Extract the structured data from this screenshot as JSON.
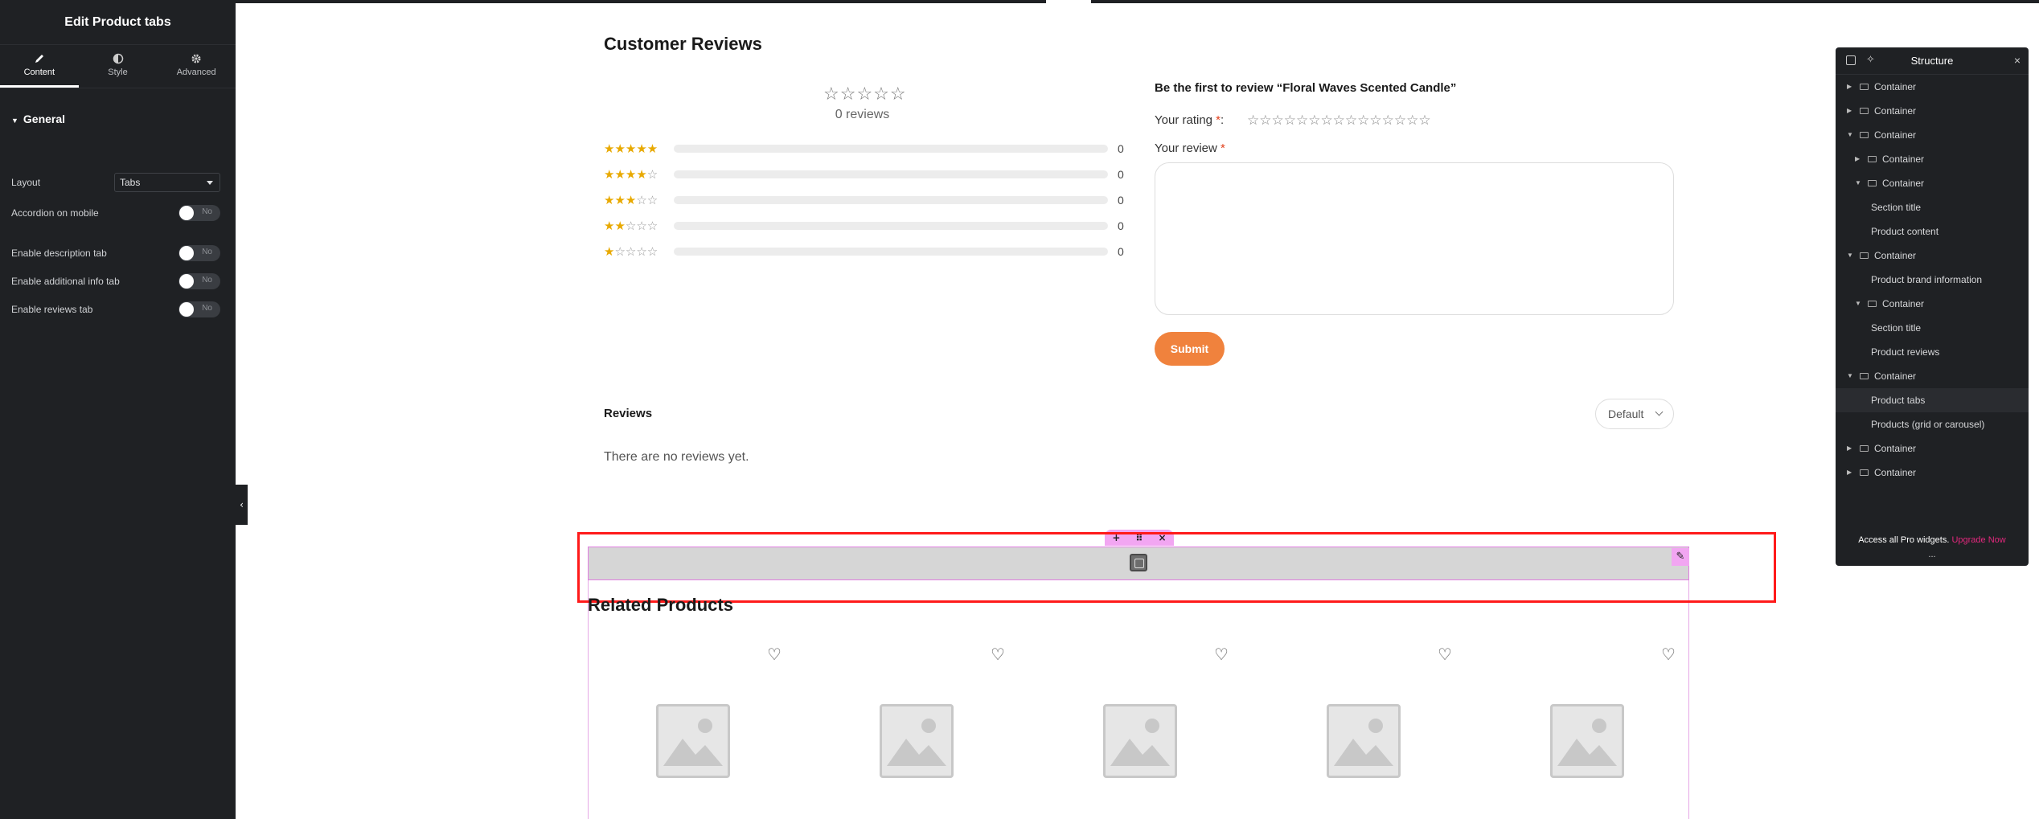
{
  "panel": {
    "title": "Edit Product tabs",
    "tabs": [
      {
        "label": "Content",
        "icon": "pencil-icon"
      },
      {
        "label": "Style",
        "icon": "half-circle-icon"
      },
      {
        "label": "Advanced",
        "icon": "gear-icon"
      }
    ],
    "section": "General",
    "layout_label": "Layout",
    "layout_value": "Tabs",
    "toggles": [
      {
        "label": "Accordion on mobile",
        "state": "No"
      },
      {
        "label": "Enable description tab",
        "state": "No"
      },
      {
        "label": "Enable additional info tab",
        "state": "No"
      },
      {
        "label": "Enable reviews tab",
        "state": "No"
      }
    ]
  },
  "reviews": {
    "title": "Customer Reviews",
    "avg_stars": "☆☆☆☆☆",
    "count_text": "0 reviews",
    "rows": [
      {
        "filled": "★★★★★",
        "empty": "",
        "count": "0"
      },
      {
        "filled": "★★★★",
        "empty": "☆",
        "count": "0"
      },
      {
        "filled": "★★★",
        "empty": "☆☆",
        "count": "0"
      },
      {
        "filled": "★★",
        "empty": "☆☆☆",
        "count": "0"
      },
      {
        "filled": "★",
        "empty": "☆☆☆☆",
        "count": "0"
      }
    ],
    "form_title": "Be the first to review “Floral Waves Scented Candle”",
    "rating_label": "Your rating",
    "rating_stars": "☆☆☆☆☆☆☆☆☆☆☆☆☆☆☆",
    "review_label": "Your review",
    "required_mark": "*",
    "submit_label": "Submit",
    "list_title": "Reviews",
    "sort_value": "Default",
    "empty_text": "There are no reviews yet."
  },
  "element_handle": {
    "add": "+",
    "move": "⠿",
    "close": "×"
  },
  "related": {
    "title": "Related Products"
  },
  "structure": {
    "title": "Structure",
    "items": [
      {
        "label": "Container",
        "level": 0,
        "expand": "right",
        "box": true
      },
      {
        "label": "Container",
        "level": 0,
        "expand": "right",
        "box": true
      },
      {
        "label": "Container",
        "level": 0,
        "expand": "down",
        "box": true
      },
      {
        "label": "Container",
        "level": 1,
        "expand": "right",
        "box": true
      },
      {
        "label": "Container",
        "level": 1,
        "expand": "down",
        "box": true
      },
      {
        "label": "Section title",
        "level": 2,
        "expand": "",
        "box": false
      },
      {
        "label": "Product content",
        "level": 2,
        "expand": "",
        "box": false
      },
      {
        "label": "Container",
        "level": 0,
        "expand": "down",
        "box": true
      },
      {
        "label": "Product brand information",
        "level": 1,
        "expand": "",
        "box": false
      },
      {
        "label": "Container",
        "level": 1,
        "expand": "down",
        "box": true
      },
      {
        "label": "Section title",
        "level": 2,
        "expand": "",
        "box": false
      },
      {
        "label": "Product reviews",
        "level": 2,
        "expand": "",
        "box": false
      },
      {
        "label": "Container",
        "level": 0,
        "expand": "down",
        "box": true
      },
      {
        "label": "Product tabs",
        "level": 1,
        "expand": "",
        "box": false,
        "active": true
      },
      {
        "label": "Products (grid or carousel)",
        "level": 1,
        "expand": "",
        "box": false
      },
      {
        "label": "Container",
        "level": 0,
        "expand": "right",
        "box": true
      },
      {
        "label": "Container",
        "level": 0,
        "expand": "right",
        "box": true
      }
    ],
    "promo_text": "Access all Pro widgets.",
    "promo_link": "Upgrade Now",
    "more": "..."
  },
  "colors": {
    "panel_bg": "#1f2124",
    "star_gold": "#e8a900",
    "submit_orange": "#f0823d",
    "selection_red": "#ff1a1a",
    "handle_pink": "#f2a6f2",
    "upgrade_pink": "#e2287d"
  }
}
